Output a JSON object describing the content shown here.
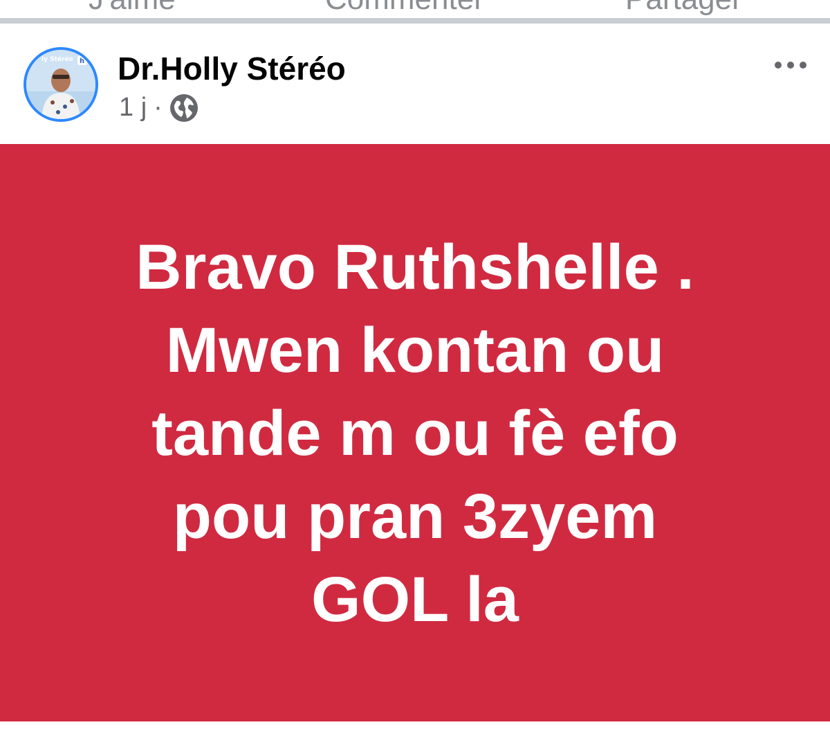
{
  "top_actions": {
    "like_label": "J'aime",
    "comment_label": "Commenter",
    "share_label": "Partager"
  },
  "post": {
    "author": "Dr.Holly Stéréo",
    "time": "1 j",
    "separator": "·",
    "privacy_icon": "globe-icon",
    "more_icon": "more-horizontal-icon",
    "avatar_text": "ly Stéréo",
    "lines": [
      "Bravo Ruthshelle .",
      "Mwen kontan ou",
      "tande m ou fè efo",
      "pou pran 3zyem",
      "GOL la"
    ],
    "background_color": "#d02a41",
    "text_color": "#ffffff"
  }
}
